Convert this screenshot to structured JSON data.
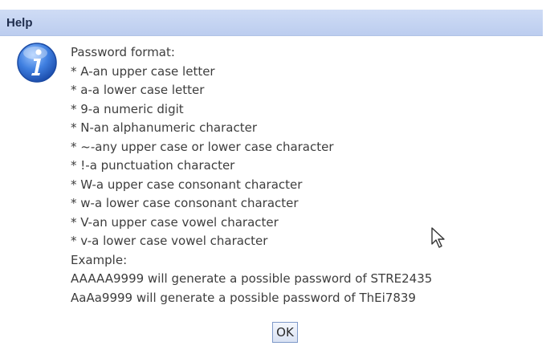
{
  "dialog": {
    "title": "Help",
    "icon": "info-icon",
    "lines": [
      "Password format:",
      "* A-an upper case letter",
      "* a-a lower case letter",
      "* 9-a numeric digit",
      "* N-an alphanumeric character",
      "* ~-any upper case or lower case character",
      "* !-a punctuation character",
      "* W-a upper case consonant character",
      "* w-a lower case consonant character",
      "* V-an upper case vowel character",
      "* v-a lower case vowel character",
      "Example:",
      "AAAAA9999 will generate a possible password of STRE2435",
      "AaAa9999 will generate a possible password of ThEi7839"
    ],
    "ok_label": "OK"
  },
  "colors": {
    "titlebar": "#c5d5f2",
    "text": "#3d3d3d",
    "icon_blue": "#2f6fd0"
  },
  "cursor_icon": "mouse-pointer-icon"
}
